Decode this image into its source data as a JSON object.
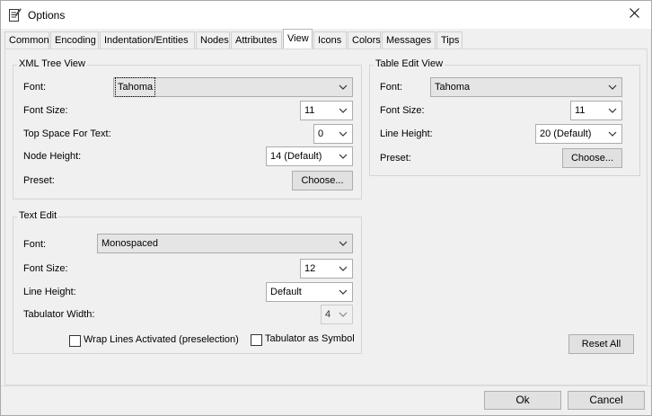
{
  "window": {
    "title": "Options",
    "close_icon": "close-icon",
    "app_icon": "document-edit-icon"
  },
  "tabs": [
    {
      "label": "Common"
    },
    {
      "label": "Encoding"
    },
    {
      "label": "Indentation/Entities"
    },
    {
      "label": "Nodes"
    },
    {
      "label": "Attributes"
    },
    {
      "label": "View",
      "active": true
    },
    {
      "label": "Icons"
    },
    {
      "label": "Colors"
    },
    {
      "label": "Messages"
    },
    {
      "label": "Tips"
    }
  ],
  "xml_tree_view": {
    "title": "XML Tree View",
    "font_label": "Font:",
    "font_value": "Tahoma",
    "font_size_label": "Font Size:",
    "font_size_value": "11",
    "top_space_label": "Top Space For Text:",
    "top_space_value": "0",
    "node_height_label": "Node Height:",
    "node_height_value": "14 (Default)",
    "preset_label": "Preset:",
    "choose_label": "Choose..."
  },
  "table_edit_view": {
    "title": "Table Edit View",
    "font_label": "Font:",
    "font_value": "Tahoma",
    "font_size_label": "Font Size:",
    "font_size_value": "11",
    "line_height_label": "Line Height:",
    "line_height_value": "20 (Default)",
    "preset_label": "Preset:",
    "choose_label": "Choose..."
  },
  "text_edit": {
    "title": "Text Edit",
    "font_label": "Font:",
    "font_value": "Monospaced",
    "font_size_label": "Font Size:",
    "font_size_value": "12",
    "line_height_label": "Line Height:",
    "line_height_value": "Default",
    "tab_width_label": "Tabulator Width:",
    "tab_width_value": "4",
    "wrap_lines_label": "Wrap Lines Activated (preselection)",
    "wrap_lines_checked": false,
    "tab_symbol_label": "Tabulator as Symbol",
    "tab_symbol_checked": false
  },
  "reset_all_label": "Reset All",
  "footer": {
    "ok_label": "Ok",
    "cancel_label": "Cancel"
  }
}
